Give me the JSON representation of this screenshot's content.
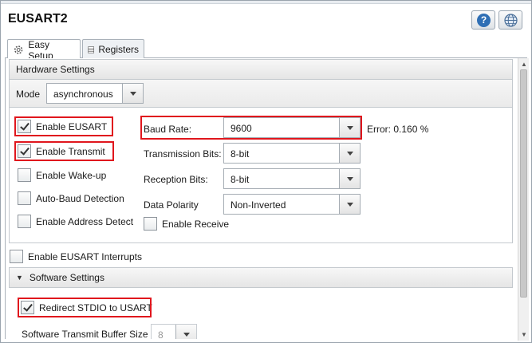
{
  "window": {
    "title": "EUSART2",
    "help_symbol": "?"
  },
  "tabs": [
    {
      "label": "Easy Setup",
      "icon": "gear-icon",
      "active": true
    },
    {
      "label": "Registers",
      "icon": "table-icon",
      "active": false
    }
  ],
  "hardware": {
    "header": "Hardware Settings",
    "mode_label": "Mode",
    "mode_value": "asynchronous",
    "checkboxes": [
      {
        "label": "Enable EUSART",
        "checked": true,
        "highlighted": true
      },
      {
        "label": "Enable Transmit",
        "checked": true,
        "highlighted": true
      },
      {
        "label": "Enable Wake-up",
        "checked": false
      },
      {
        "label": "Auto-Baud Detection",
        "checked": false
      },
      {
        "label": "Enable Address Detect",
        "checked": false
      }
    ],
    "baud_rate": {
      "label": "Baud Rate:",
      "value": "9600",
      "error": "Error: 0.160 %",
      "highlighted": true
    },
    "transmission_bits": {
      "label": "Transmission Bits:",
      "value": "8-bit"
    },
    "reception_bits": {
      "label": "Reception Bits:",
      "value": "8-bit"
    },
    "data_polarity": {
      "label": "Data Polarity",
      "value": "Non-Inverted"
    },
    "enable_receive": {
      "label": "Enable Receive",
      "checked": false
    }
  },
  "interrupts": {
    "label": "Enable EUSART Interrupts",
    "checked": false
  },
  "software": {
    "header": "Software Settings",
    "redirect_stdio": {
      "label": "Redirect STDIO to USART",
      "checked": true,
      "highlighted": true
    },
    "tx_buffer_label": "Software Transmit Buffer Size",
    "tx_buffer_value": "8"
  },
  "colors": {
    "highlight": "#e0161d",
    "help_button": "#2f6fb5"
  }
}
